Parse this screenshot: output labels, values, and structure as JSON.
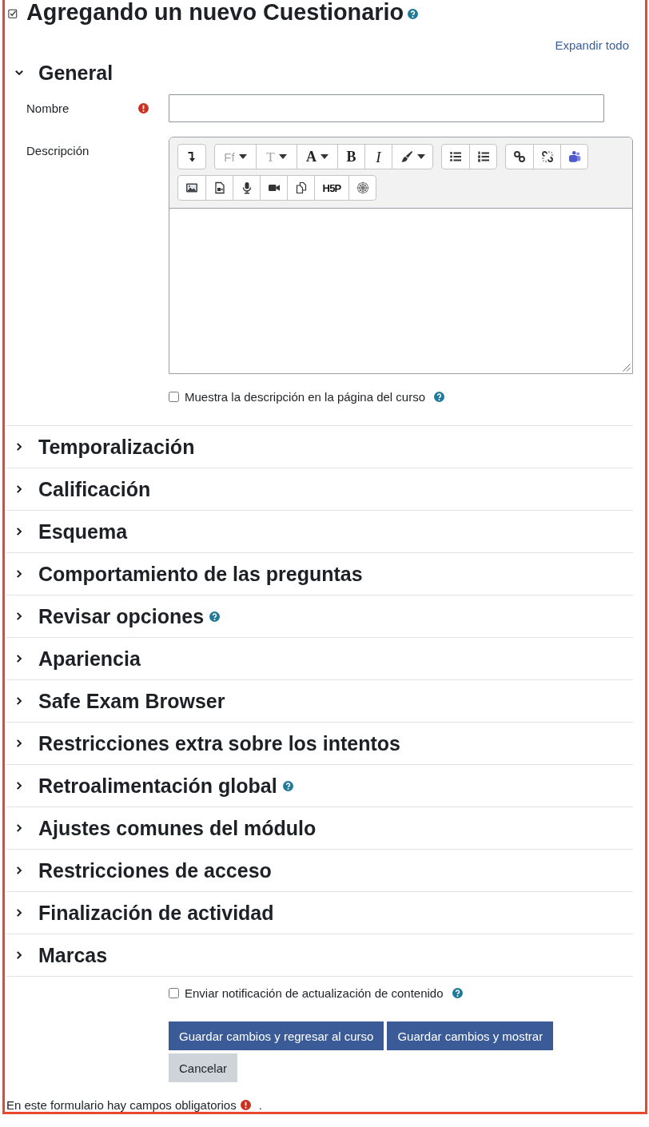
{
  "title": {
    "text": "Agregando un nuevo Cuestionario",
    "help": true
  },
  "expand_all": "Expandir todo",
  "general": {
    "heading": "General",
    "expanded": true,
    "name_field": {
      "label": "Nombre",
      "required": true
    },
    "description_field": {
      "label": "Descripción",
      "toolbar_rows": [
        {
          "groups": [
            {
              "buttons": [
                {
                  "kind": "icon",
                  "dropdown": false,
                  "disabled": false
                }
              ]
            },
            {
              "buttons": [
                {
                  "kind": "sans",
                  "label": "Ff",
                  "dropdown": true,
                  "disabled": true
                },
                {
                  "kind": "plain",
                  "label": "T",
                  "dropdown": true,
                  "disabled": true
                },
                {
                  "kind": "bold",
                  "label": "A",
                  "dropdown": true,
                  "disabled": false
                },
                {
                  "kind": "bold",
                  "label": "B",
                  "dropdown": false,
                  "disabled": false
                },
                {
                  "kind": "italic",
                  "label": "I",
                  "dropdown": false,
                  "disabled": false
                },
                {
                  "kind": "icon",
                  "dropdown": true,
                  "disabled": false
                }
              ]
            },
            {
              "buttons": [
                {
                  "kind": "icon",
                  "dropdown": false,
                  "disabled": false
                },
                {
                  "kind": "icon",
                  "dropdown": false,
                  "disabled": false
                }
              ]
            },
            {
              "buttons": [
                {
                  "kind": "icon",
                  "dropdown": false,
                  "disabled": false
                },
                {
                  "kind": "icon",
                  "dropdown": false,
                  "disabled": false
                },
                {
                  "kind": "icon",
                  "dropdown": false,
                  "disabled": false
                }
              ]
            }
          ]
        },
        {
          "groups": [
            {
              "buttons": [
                {
                  "kind": "icon",
                  "dropdown": false,
                  "disabled": false
                },
                {
                  "kind": "icon",
                  "dropdown": false,
                  "disabled": false
                },
                {
                  "kind": "icon",
                  "dropdown": false,
                  "disabled": false
                },
                {
                  "kind": "icon",
                  "dropdown": false,
                  "disabled": false
                },
                {
                  "kind": "icon",
                  "dropdown": false,
                  "disabled": false
                },
                {
                  "kind": "logo",
                  "label": "H5P",
                  "dropdown": false,
                  "disabled": false
                },
                {
                  "kind": "icon",
                  "dropdown": false,
                  "disabled": false
                }
              ]
            }
          ]
        }
      ]
    },
    "show_description": {
      "label": "Muestra la descripción en la página del curso",
      "checked": false,
      "help": true
    }
  },
  "sections": [
    {
      "heading": "Temporalización",
      "expanded": false,
      "help": false
    },
    {
      "heading": "Calificación",
      "expanded": false,
      "help": false
    },
    {
      "heading": "Esquema",
      "expanded": false,
      "help": false
    },
    {
      "heading": "Comportamiento de las preguntas",
      "expanded": false,
      "help": false
    },
    {
      "heading": "Revisar opciones",
      "expanded": false,
      "help": true
    },
    {
      "heading": "Apariencia",
      "expanded": false,
      "help": false
    },
    {
      "heading": "Safe Exam Browser",
      "expanded": false,
      "help": false
    },
    {
      "heading": "Restricciones extra sobre los intentos",
      "expanded": false,
      "help": false
    },
    {
      "heading": "Retroalimentación global",
      "expanded": false,
      "help": true
    },
    {
      "heading": "Ajustes comunes del módulo",
      "expanded": false,
      "help": false
    },
    {
      "heading": "Restricciones de acceso",
      "expanded": false,
      "help": false
    },
    {
      "heading": "Finalización de actividad",
      "expanded": false,
      "help": false
    },
    {
      "heading": "Marcas",
      "expanded": false,
      "help": false
    }
  ],
  "notify": {
    "label": "Enviar notificación de actualización de contenido",
    "checked": false,
    "help": true
  },
  "buttons": [
    {
      "kind": "primary",
      "label": "Guardar cambios y regresar al curso"
    },
    {
      "kind": "primary",
      "label": "Guardar cambios y mostrar"
    },
    {
      "kind": "secondary",
      "label": "Cancelar"
    }
  ],
  "footer": {
    "text": "En este formulario hay campos obligatorios",
    "required_mark": true,
    "suffix": "."
  }
}
